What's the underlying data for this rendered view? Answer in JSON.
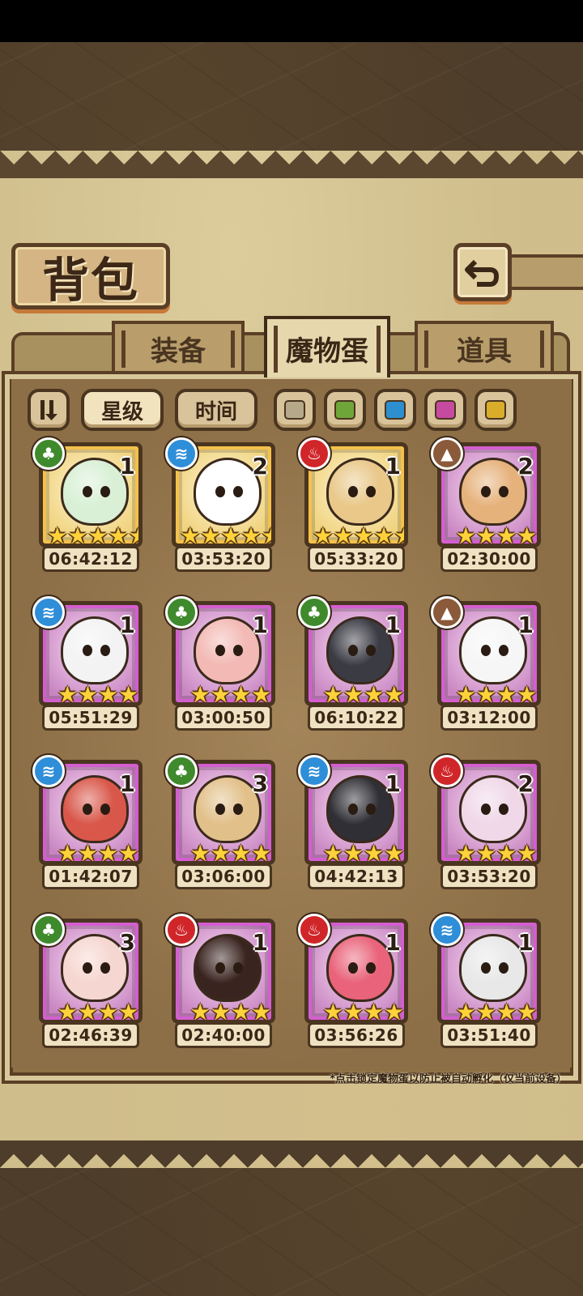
{
  "title": "背包",
  "tabs": [
    {
      "label": "装备",
      "active": false
    },
    {
      "label": "魔物蛋",
      "active": true
    },
    {
      "label": "道具",
      "active": false
    }
  ],
  "filters": {
    "sort_toggle_icon": "sort-toggle-icon",
    "star_label": "星级",
    "time_label": "时间",
    "colors": [
      "#b5a98a",
      "#6ea63a",
      "#2e8fd0",
      "#c54aa0",
      "#d9ad2a"
    ]
  },
  "eggs": [
    {
      "element": "grass",
      "count": "1",
      "stars": "★★★★★",
      "rarity": "gold",
      "timer": "06:42:12",
      "color": "#d9f0d6"
    },
    {
      "element": "water",
      "count": "2",
      "stars": "★★★★★",
      "rarity": "gold",
      "timer": "03:53:20",
      "color": "#ffffff"
    },
    {
      "element": "fire",
      "count": "1",
      "stars": "★★★★★",
      "rarity": "gold",
      "timer": "05:33:20",
      "color": "#e9c88a"
    },
    {
      "element": "earth",
      "count": "2",
      "stars": "★★★★",
      "rarity": "purple",
      "timer": "02:30:00",
      "color": "#e6b27c"
    },
    {
      "element": "water",
      "count": "1",
      "stars": "★★★★",
      "rarity": "purple",
      "timer": "05:51:29",
      "color": "#f3f3f3"
    },
    {
      "element": "grass",
      "count": "1",
      "stars": "★★★★",
      "rarity": "purple",
      "timer": "03:00:50",
      "color": "#f3b9b4"
    },
    {
      "element": "grass",
      "count": "1",
      "stars": "★★★★",
      "rarity": "purple",
      "timer": "06:10:22",
      "color": "#3b3b44"
    },
    {
      "element": "earth",
      "count": "1",
      "stars": "★★★★",
      "rarity": "purple",
      "timer": "03:12:00",
      "color": "#f6f6f6"
    },
    {
      "element": "water",
      "count": "1",
      "stars": "★★★★",
      "rarity": "purple",
      "timer": "01:42:07",
      "color": "#d9574a"
    },
    {
      "element": "grass",
      "count": "3",
      "stars": "★★★★",
      "rarity": "purple",
      "timer": "03:06:00",
      "color": "#e2c08a"
    },
    {
      "element": "water",
      "count": "1",
      "stars": "★★★★",
      "rarity": "purple",
      "timer": "04:42:13",
      "color": "#2f2f35"
    },
    {
      "element": "fire",
      "count": "2",
      "stars": "★★★★",
      "rarity": "purple",
      "timer": "03:53:20",
      "color": "#f0d8e8"
    },
    {
      "element": "grass",
      "count": "3",
      "stars": "★★★★",
      "rarity": "purple",
      "timer": "02:46:39",
      "color": "#f6d6d0"
    },
    {
      "element": "fire",
      "count": "1",
      "stars": "★★★★",
      "rarity": "purple",
      "timer": "02:40:00",
      "color": "#3a2420"
    },
    {
      "element": "fire",
      "count": "1",
      "stars": "★★★★",
      "rarity": "purple",
      "timer": "03:56:26",
      "color": "#e9637a"
    },
    {
      "element": "water",
      "count": "1",
      "stars": "★★★★",
      "rarity": "purple",
      "timer": "03:51:40",
      "color": "#e8e8e8"
    }
  ],
  "note": "*点击锁定魔物蛋以防止被自动孵化（仅当前设备）"
}
